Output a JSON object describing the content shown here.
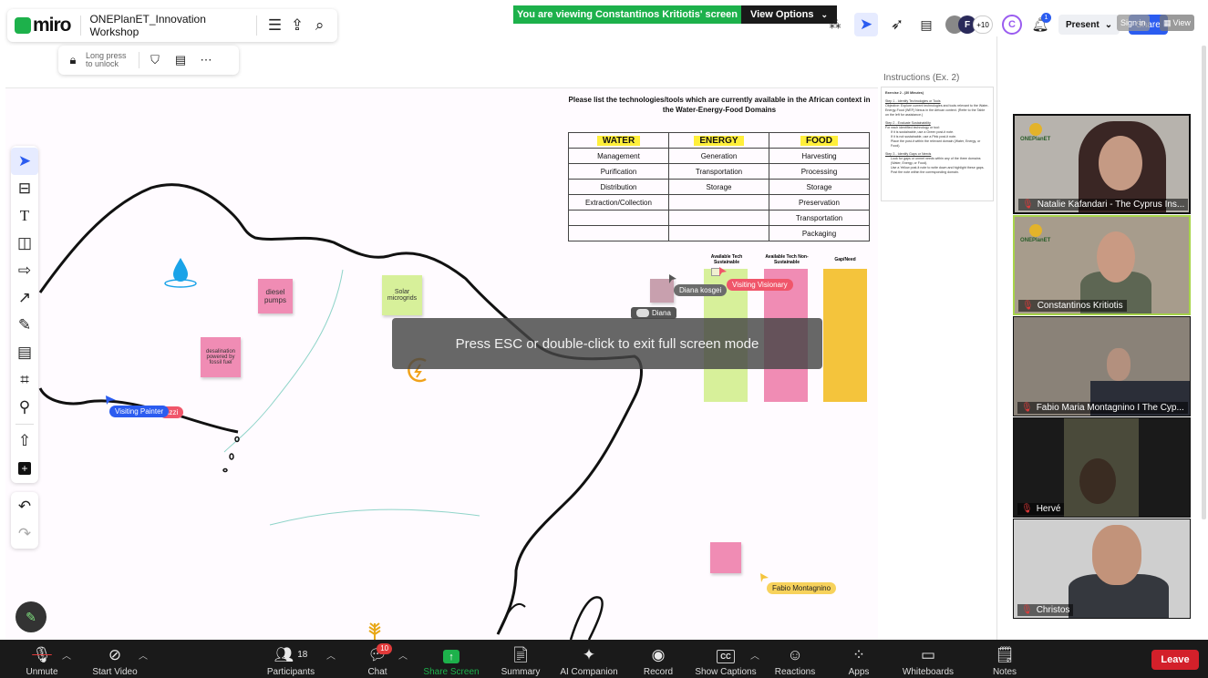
{
  "miro": {
    "logo": "miro",
    "board_title": "ONEPlanET_Innovation Workshop",
    "lock_label": "Long press to unlock",
    "present_label": "Present",
    "share_label": "Share",
    "collab_count": "+10",
    "notif_count": "1",
    "avatar_letter": "C",
    "avatar_letter2": "F",
    "signin_label": "Sign in",
    "view_label": "View"
  },
  "banner": {
    "viewing_text": "You are viewing Constantinos Kritiotis' screen",
    "view_options": "View Options"
  },
  "instructions": {
    "panel_title": "Instructions (Ex. 2)",
    "heading": "Exercise 2 - (30 Minutes)",
    "step1_title": "Step 1 - Identify Technologies or Tools",
    "step1_text": "Objective: Explore current technologies and tools relevant to the Water-Energy-Food (WEF) Nexus in the African context. (Refer to the Table on the left for assistance.)",
    "step2_title": "Step 2 - Evaluate Sustainability",
    "step2_text": "For each identified technology or tool:",
    "step2_b1": "If it is sustainable, use a Green post-it note.",
    "step2_b2": "If it is not sustainable, use a Pink post-it note.",
    "step2_b3": "Place the post-it within the relevant domain (Water, Energy, or Food).",
    "step3_title": "Step 3 - Identify Gaps or Needs",
    "step3_b1": "Look for gaps or unmet needs within any of the three domains (Water, Energy, or Food).",
    "step3_b2": "Use a Yellow post-it note to write down and highlight these gaps.",
    "step3_b3": "Post the note within the corresponding domain."
  },
  "board": {
    "question": "Please list the technologies/tools which are currently available in the African context in the Water-Energy-Food Domains",
    "table": {
      "headers": [
        "WATER",
        "ENERGY",
        "FOOD"
      ],
      "rows": [
        [
          "Management",
          "Generation",
          "Harvesting"
        ],
        [
          "Purification",
          "Transportation",
          "Processing"
        ],
        [
          "Distribution",
          "Storage",
          "Storage"
        ],
        [
          "Extraction/Collection",
          "",
          "Preservation"
        ],
        [
          "",
          "",
          "Transportation"
        ],
        [
          "",
          "",
          "Packaging"
        ]
      ]
    },
    "columns": {
      "available_sustainable": "Available Tech Sustainable",
      "available_not_sustainable": "Available Tech Non- Sustainable",
      "gap_need": "Gap/Need"
    },
    "stickies": {
      "diesel": "diesel pumps",
      "solar": "Solar microgrids",
      "desalination": "desalination powered by fossil fuel"
    },
    "cursors": {
      "diana_kosgei": "Diana kosgei",
      "visiting_visionary": "Visiting Visionary",
      "diana": "Diana",
      "visiting_painter": "Visiting Painter",
      "painter_suffix": "azzi",
      "fabio": "Fabio Montagnino"
    },
    "fullscreen_toast": "Press ESC or double-click to exit full screen mode"
  },
  "participants": [
    {
      "name": "Natalie Kafandari - The Cyprus Ins...",
      "logo": "ONEPlanET"
    },
    {
      "name": "Constantinos Kritiotis",
      "logo": "ONEPlanET"
    },
    {
      "name": "Fabio Maria Montagnino I The Cyp..."
    },
    {
      "name": "Hervé"
    },
    {
      "name": "Christos"
    }
  ],
  "zoom_toolbar": {
    "unmute": "Unmute",
    "start_video": "Start Video",
    "participants": "Participants",
    "participants_count": "18",
    "chat": "Chat",
    "chat_badge": "10",
    "share_screen": "Share Screen",
    "summary": "Summary",
    "ai_companion": "AI Companion",
    "record": "Record",
    "show_captions": "Show Captions",
    "cc": "CC",
    "reactions": "Reactions",
    "apps": "Apps",
    "whiteboards": "Whiteboards",
    "notes": "Notes",
    "leave": "Leave"
  },
  "colors": {
    "zoom_green": "#1db14b",
    "zoom_bar": "#1a1a1a",
    "leave_red": "#d3202a",
    "sticky_green": "#d7f09a",
    "sticky_pink": "#f08cb4",
    "sticky_yellow": "#f4c43c",
    "miro_blue": "#2b5cf0"
  }
}
